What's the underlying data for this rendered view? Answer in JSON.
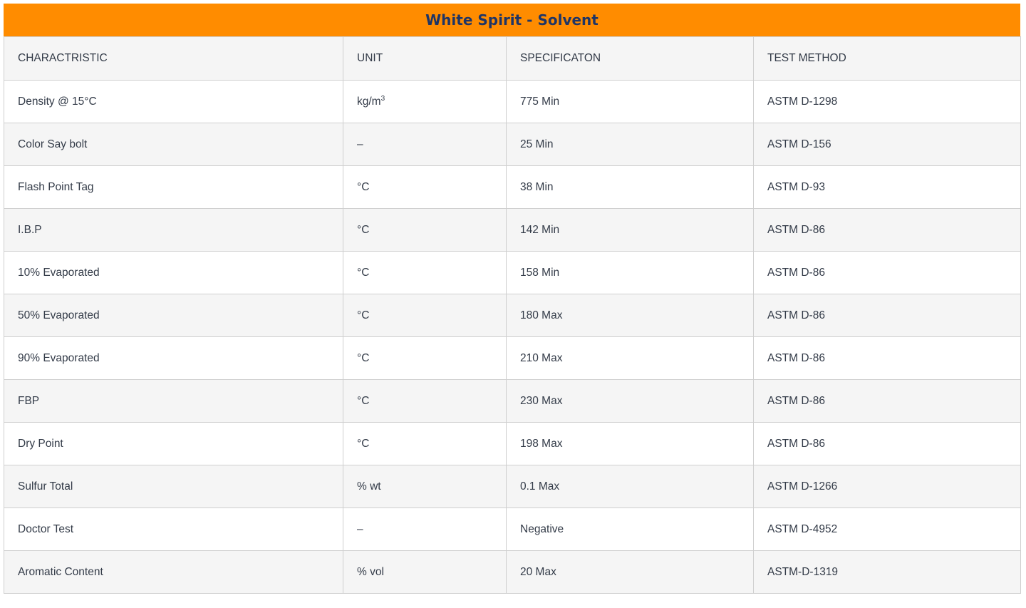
{
  "title": "White Spirit - Solvent",
  "headers": [
    "CHARACTRISTIC",
    "UNIT",
    "SPECIFICATON",
    "TEST METHOD"
  ],
  "rows": [
    {
      "characteristic": "Density @ 15°C",
      "unit": "kg/m",
      "unit_sup": "3",
      "spec": "775 Min",
      "method": "ASTM D-1298"
    },
    {
      "characteristic": "Color Say bolt",
      "unit": "–",
      "spec": "25 Min",
      "method": "ASTM D-156"
    },
    {
      "characteristic": "Flash Point Tag",
      "unit": "°C",
      "spec": "38 Min",
      "method": "ASTM D-93"
    },
    {
      "characteristic": "I.B.P",
      "unit": "°C",
      "spec": "142 Min",
      "method": "ASTM D-86"
    },
    {
      "characteristic": "10% Evaporated",
      "unit": "°C",
      "spec": "158 Min",
      "method": "ASTM D-86"
    },
    {
      "characteristic": "50% Evaporated",
      "unit": "°C",
      "spec": "180 Max",
      "method": "ASTM D-86"
    },
    {
      "characteristic": "90% Evaporated",
      "unit": "°C",
      "spec": "210 Max",
      "method": "ASTM D-86"
    },
    {
      "characteristic": "FBP",
      "unit": "°C",
      "spec": "230 Max",
      "method": "ASTM D-86"
    },
    {
      "characteristic": "Dry Point",
      "unit": "°C",
      "spec": "198 Max",
      "method": "ASTM D-86"
    },
    {
      "characteristic": "Sulfur Total",
      "unit": "% wt",
      "spec": "0.1 Max",
      "method": "ASTM D-1266"
    },
    {
      "characteristic": "Doctor Test",
      "unit": "–",
      "spec": "Negative",
      "method": "ASTM D-4952"
    },
    {
      "characteristic": "Aromatic Content",
      "unit": "% vol",
      "spec": "20 Max",
      "method": "ASTM-D-1319"
    }
  ],
  "colors": {
    "title_bg": "#ff8c00",
    "title_text": "#1f3566",
    "row_alt": "#f5f5f5",
    "border": "#cfcfcf",
    "text": "#333b48"
  }
}
